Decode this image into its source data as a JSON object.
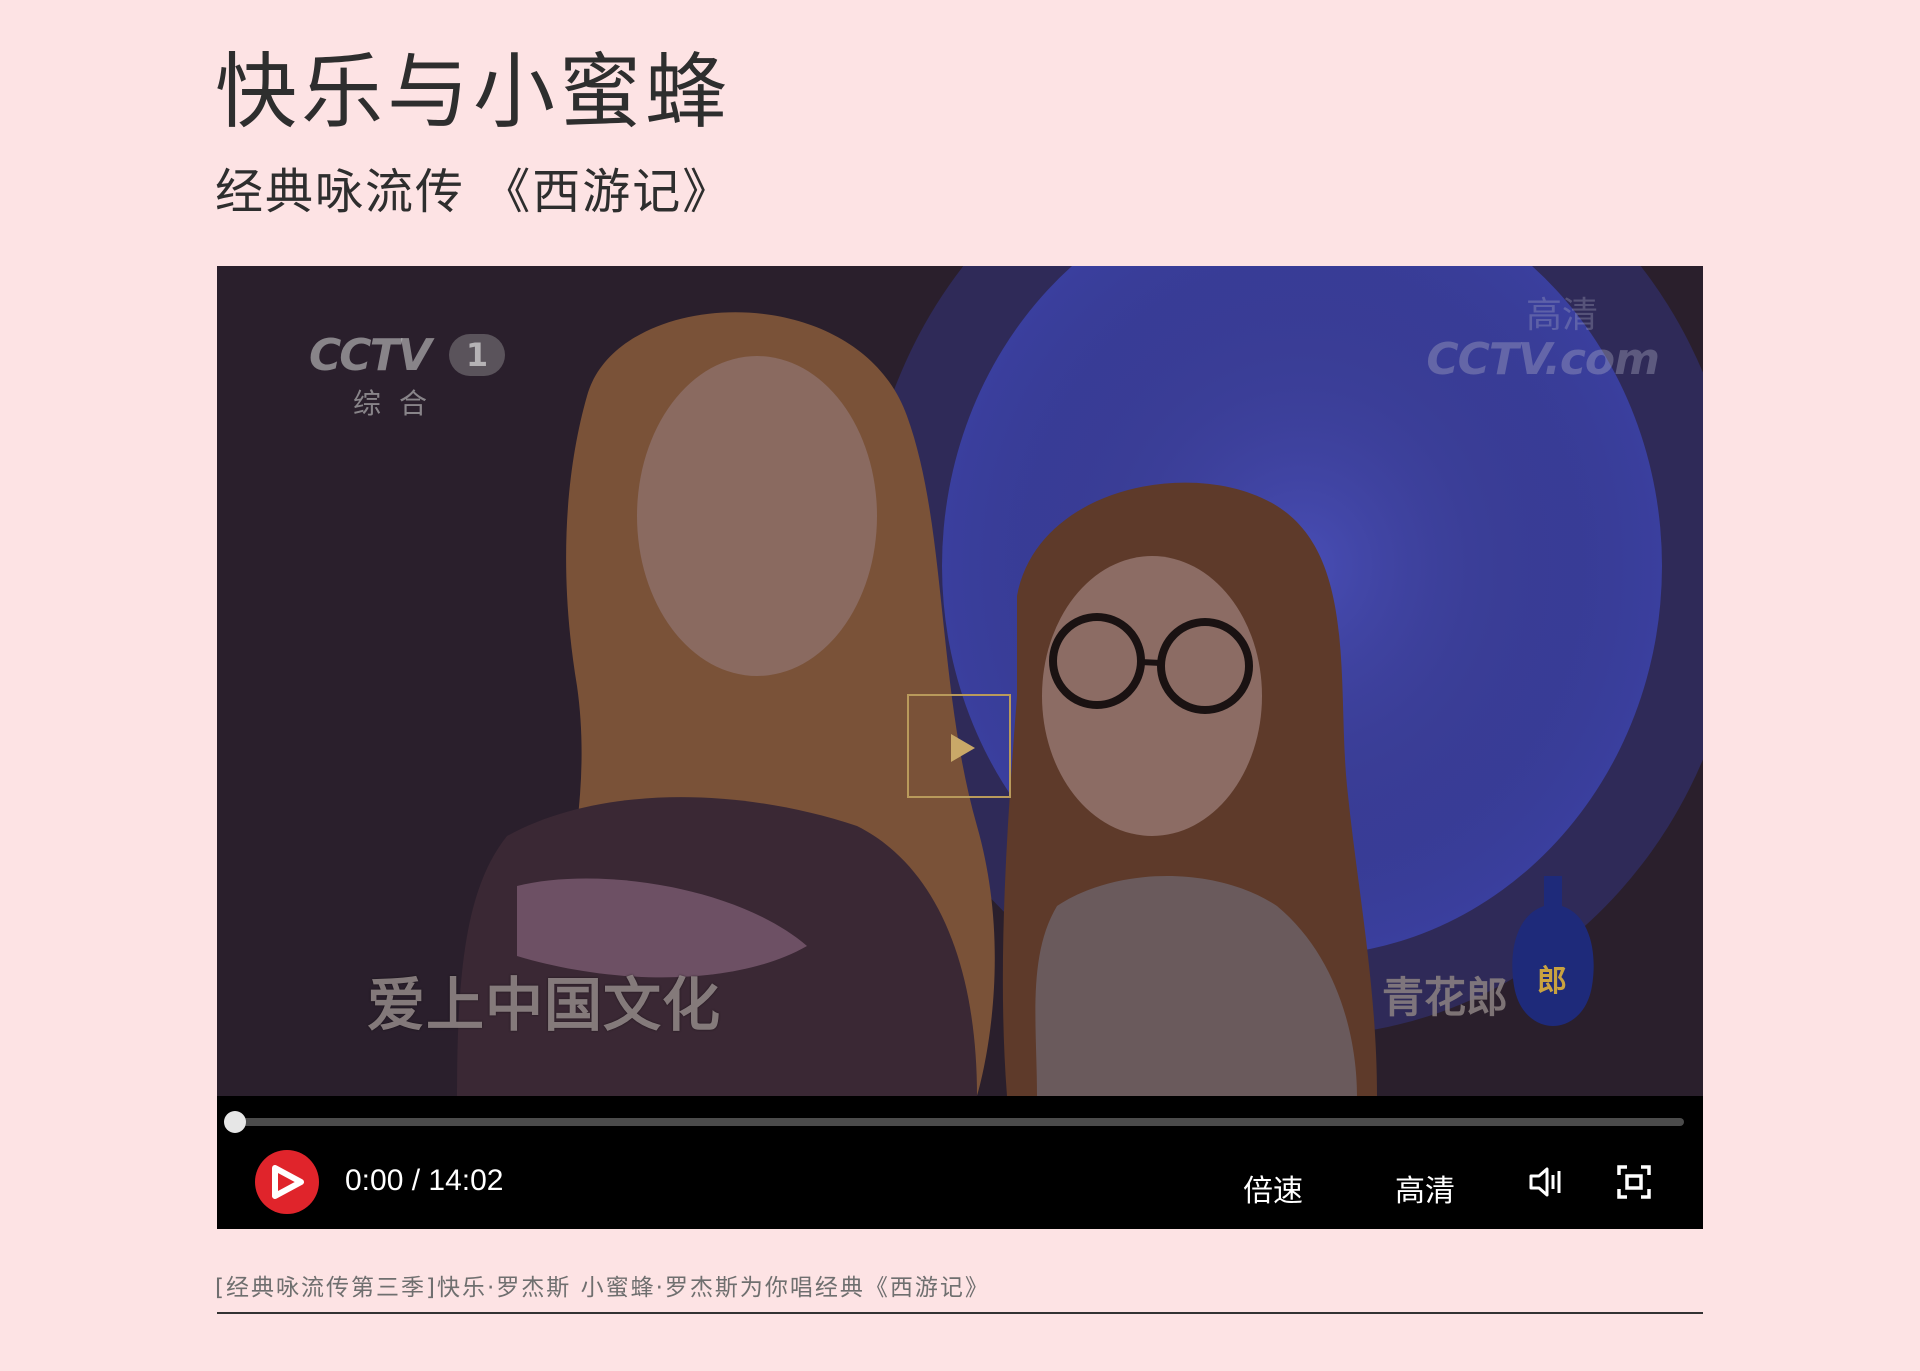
{
  "page": {
    "title": "快乐与小蜜蜂",
    "subtitle": "经典咏流传 《西游记》",
    "description": "[经典咏流传第三季]快乐·罗杰斯  小蜜蜂·罗杰斯为你唱经典《西游记》"
  },
  "video": {
    "channel_logo": "CCTV",
    "channel_number": "1",
    "channel_sub": "综合",
    "watermark": "CCTV.com",
    "watermark_hd": "高清",
    "on_screen_caption": "爱上中国文化",
    "ad_text": "青花郎",
    "ad_bottle_char": "郎"
  },
  "controls": {
    "time": "0:00 / 14:02",
    "progress": 0.0,
    "speed_label": "倍速",
    "quality_label": "高清",
    "icons": [
      "play-logo-icon",
      "volume-icon",
      "fullscreen-icon"
    ]
  },
  "colors": {
    "background": "#fde3e4",
    "play_border": "#b99a5b",
    "logo_red": "#e0242b"
  }
}
